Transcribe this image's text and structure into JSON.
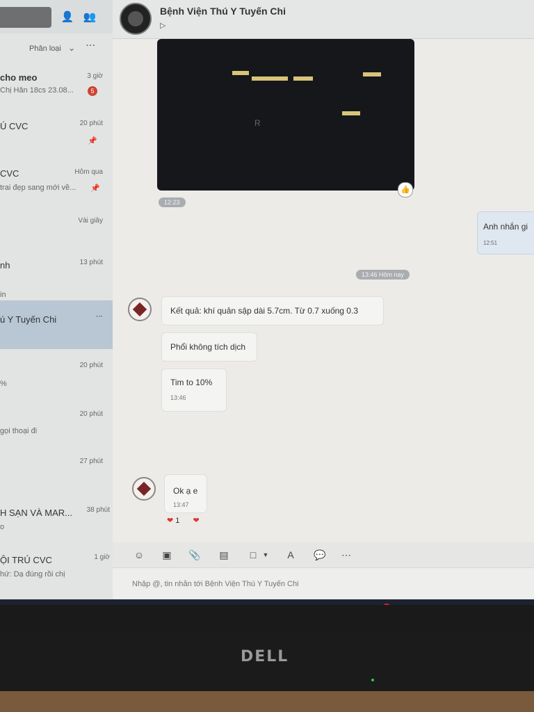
{
  "sidebar": {
    "filter_label": "Phân loại",
    "filter_more": "···",
    "items": [
      {
        "name": "cho meo",
        "time": "3 giờ",
        "preview": "Chị Hân 18cs 23.08...",
        "badge": "5"
      },
      {
        "name": "Ú CVC",
        "time": "20 phút",
        "preview": ""
      },
      {
        "name": "CVC",
        "time": "Hôm qua",
        "preview": "trai đẹp sang mới về..."
      },
      {
        "name": "",
        "time": "Vài giây",
        "preview": ""
      },
      {
        "name": "nh",
        "time": "13 phút",
        "preview": "in"
      },
      {
        "name": "ú Y Tuyến Chi",
        "time": "···",
        "preview": ""
      },
      {
        "name": "",
        "time": "20 phút",
        "preview": "%"
      },
      {
        "name": "",
        "time": "20 phút",
        "preview": "gọi thoại đi"
      },
      {
        "name": "",
        "time": "27 phút",
        "preview": ""
      },
      {
        "name": "H SẠN VÀ MAR...",
        "time": "38 phút",
        "preview": "o"
      },
      {
        "name": "ỘI TRÚ CVC",
        "time": "1 giờ",
        "preview": "hứ: Dạ đúng rồi chị"
      }
    ]
  },
  "chat": {
    "title": "Bệnh Viện Thú Y Tuyến Chi",
    "subtitle_icon": "label-icon",
    "image_message_time": "12:23",
    "image_letter": "R",
    "outgoing_text": "Anh nhắn gi",
    "outgoing_time": "12:51",
    "divider_time": "13:46 Hôm nay",
    "incoming": [
      {
        "text": "Kết quả: khí quản sập dài 5.7cm. Từ 0.7 xuống 0.3",
        "time": ""
      },
      {
        "text": "Phổi không tích dịch",
        "time": ""
      },
      {
        "text": "Tim to 10%",
        "time": "13:46"
      }
    ],
    "reply": {
      "text": "Ok ạ e",
      "time": "13:47",
      "reaction_count": "1"
    }
  },
  "composer": {
    "placeholder": "Nhập @, tin nhắn tới Bệnh Viện Thú Y Tuyến Chi"
  },
  "monitor": {
    "brand": "DELL"
  }
}
